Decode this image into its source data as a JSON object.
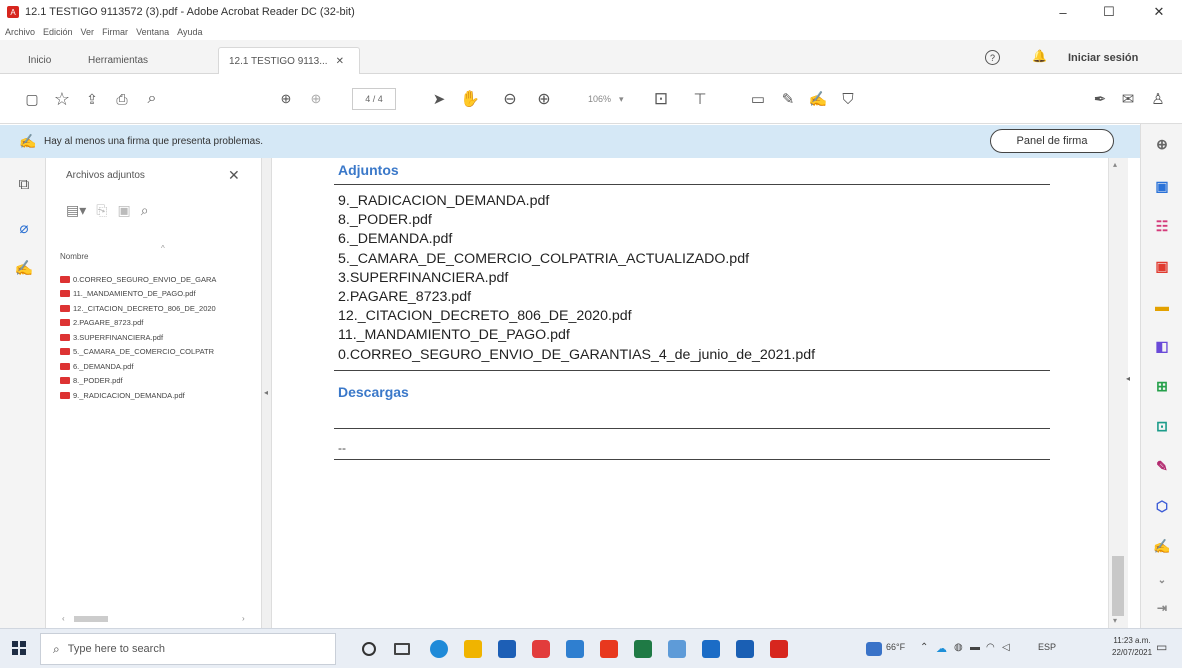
{
  "window": {
    "title": "12.1 TESTIGO 9113572 (3).pdf - Adobe Acrobat Reader DC (32-bit)",
    "minimize": "–",
    "maximize": "☐",
    "close": "✕"
  },
  "menu": [
    "Archivo",
    "Edición",
    "Ver",
    "Firmar",
    "Ventana",
    "Ayuda"
  ],
  "tabs": {
    "home": "Inicio",
    "tools": "Herramientas",
    "document": "12.1 TESTIGO 9113...",
    "close": "✕",
    "help": "?",
    "signin": "Iniciar sesión"
  },
  "toolbar": {
    "page": "4 / 4",
    "zoom": "106%"
  },
  "banner": {
    "message": "Hay al menos una firma que presenta problemas.",
    "button": "Panel de firma"
  },
  "attachments": {
    "title": "Archivos adjuntos",
    "column": "Nombre",
    "files": [
      "0.CORREO_SEGURO_ENVIO_DE_GARA",
      "11._MANDAMIENTO_DE_PAGO.pdf",
      "12._CITACION_DECRETO_806_DE_2020",
      "2.PAGARE_8723.pdf",
      "3.SUPERFINANCIERA.pdf",
      "5._CAMARA_DE_COMERCIO_COLPATR",
      "6._DEMANDA.pdf",
      "8._PODER.pdf",
      "9._RADICACION_DEMANDA.pdf"
    ]
  },
  "document": {
    "adjuntos_title": "Adjuntos",
    "files": [
      "9._RADICACION_DEMANDA.pdf",
      "8._PODER.pdf",
      "6._DEMANDA.pdf",
      "5._CAMARA_DE_COMERCIO_COLPATRIA_ACTUALIZADO.pdf",
      "3.SUPERFINANCIERA.pdf",
      "2.PAGARE_8723.pdf",
      "12._CITACION_DECRETO_806_DE_2020.pdf",
      "11._MANDAMIENTO_DE_PAGO.pdf",
      "0.CORREO_SEGURO_ENVIO_DE_GARANTIAS_4_de_junio_de_2021.pdf"
    ],
    "descargas_title": "Descargas",
    "descargas_value": "--"
  },
  "taskbar": {
    "search_placeholder": "Type here to search",
    "weather": "66°F",
    "language": "ESP",
    "time": "11:23 a.m.",
    "date": "22/07/2021"
  },
  "colors": {
    "accent_blue": "#3a78c9",
    "banner_bg": "#d5e8f6",
    "pdf_red": "#d33333"
  }
}
